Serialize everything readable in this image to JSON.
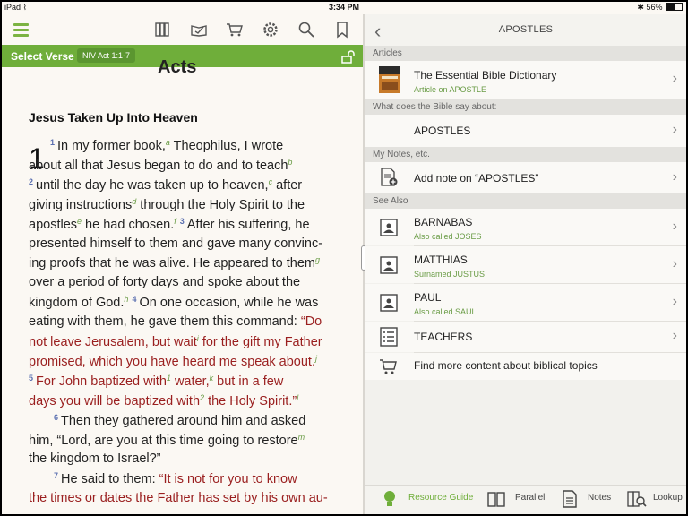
{
  "status": {
    "device": "iPad",
    "time": "3:34 PM",
    "battery": "56%"
  },
  "toolbar": {
    "menu": "hamburger-icon",
    "icons": [
      "library-icon",
      "reading-plan-icon",
      "cart-icon",
      "settings-icon",
      "search-icon",
      "bookmark-icon"
    ]
  },
  "verse_bar": {
    "label": "Select Verse",
    "reference": "NIV Act 1:1-7"
  },
  "reader": {
    "book_title": "Acts",
    "heading": "Jesus Taken Up Into Heaven",
    "chapter": "1",
    "lines": [
      [
        {
          "v": "1"
        },
        {
          "t": "In my former book,"
        },
        {
          "f": "a"
        },
        {
          "t": " Theophilus, I wrote"
        }
      ],
      [
        {
          "t": "about all that Jesus began to do and to teach"
        },
        {
          "f": "b"
        }
      ],
      [
        {
          "v": "2"
        },
        {
          "t": "until the day he was taken up to heaven,"
        },
        {
          "f": "c"
        },
        {
          "t": " after"
        }
      ],
      [
        {
          "t": "giving instructions"
        },
        {
          "f": "d"
        },
        {
          "t": " through the Holy Spirit to the"
        }
      ],
      [
        {
          "t": "apostles"
        },
        {
          "f": "e"
        },
        {
          "t": " he had chosen."
        },
        {
          "f": "f"
        },
        {
          "t": "  "
        },
        {
          "v": "3"
        },
        {
          "t": "After his suffering, he"
        }
      ],
      [
        {
          "t": "presented himself to them and gave many convinc-"
        }
      ],
      [
        {
          "t": "ing proofs that he was alive. He appeared to them"
        },
        {
          "f": "g"
        }
      ],
      [
        {
          "t": "over a period of forty days and spoke about the"
        }
      ],
      [
        {
          "t": "kingdom of God."
        },
        {
          "f": "h"
        },
        {
          "t": "  "
        },
        {
          "v": "4"
        },
        {
          "t": "On one occasion, while he was"
        }
      ],
      [
        {
          "t": "eating with them, he gave them this command: "
        },
        {
          "r": "“Do"
        }
      ],
      [
        {
          "r": "not leave Jerusalem, but wait"
        },
        {
          "f": "i"
        },
        {
          "r": " for the gift my Father"
        }
      ],
      [
        {
          "r": "promised, which you have heard me speak about."
        },
        {
          "f": "j"
        }
      ],
      [
        {
          "v": "5"
        },
        {
          "r": "For John baptized with"
        },
        {
          "f": "1"
        },
        {
          "r": " water,"
        },
        {
          "f": "k"
        },
        {
          "r": " but in a few"
        }
      ],
      [
        {
          "r": "days you will be baptized with"
        },
        {
          "f": "2"
        },
        {
          "r": " the Holy Spirit.”"
        },
        {
          "f": "l"
        }
      ],
      [
        {
          "v": "6"
        },
        {
          "t": "Then they gathered around him and asked"
        }
      ],
      [
        {
          "t": "him, “Lord, are you at this time going to restore"
        },
        {
          "f": "m"
        }
      ],
      [
        {
          "t": "the kingdom to Israel?”"
        }
      ],
      [
        {
          "v": "7"
        },
        {
          "t": "He said to them: "
        },
        {
          "r": "“It is not for you to know"
        }
      ],
      [
        {
          "r": "the times or dates the Father has set by his own au-"
        }
      ]
    ]
  },
  "guide": {
    "title": "APOSTLES",
    "sections": {
      "articles": "Articles",
      "bible_say": "What does the Bible say about:",
      "notes": "My Notes, etc.",
      "see_also": "See Also"
    },
    "article": {
      "title": "The Essential Bible Dictionary",
      "subtitle": "Article on APOSTLE"
    },
    "topic": {
      "title": "APOSTLES"
    },
    "note": {
      "title": "Add note on “APOSTLES”"
    },
    "see_also": [
      {
        "title": "BARNABAS",
        "subtitle": "Also called JOSES"
      },
      {
        "title": "MATTHIAS",
        "subtitle": "Surnamed JUSTUS"
      },
      {
        "title": "PAUL",
        "subtitle": "Also called SAUL"
      },
      {
        "title": "TEACHERS",
        "subtitle": ""
      }
    ],
    "more": {
      "title": "Find more content about biblical topics"
    }
  },
  "bottom_tabs": {
    "resource_guide": "Resource Guide",
    "parallel": "Parallel",
    "notes": "Notes",
    "lookup": "Lookup"
  },
  "colors": {
    "accent_green": "#6fae3a",
    "words_of_christ": "#9a1f1f",
    "verse_number": "#5a6fb0"
  }
}
